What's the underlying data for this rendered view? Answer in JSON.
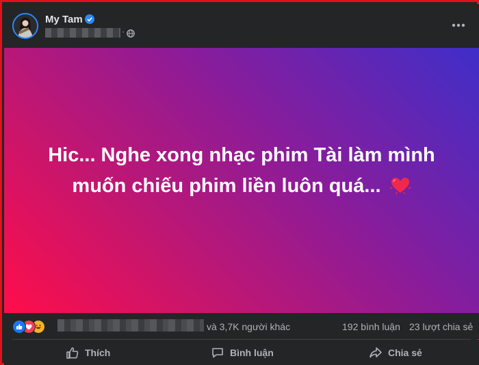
{
  "post": {
    "author": "My Tam",
    "status_text_line1": "Hic... Nghe xong nhạc phim Tài làm mình",
    "status_text_line2": "muốn chiếu phim liền luôn quá...",
    "background_colors": [
      "#ff0d4a",
      "#8a1c9a",
      "#3f2ec9"
    ]
  },
  "stats": {
    "others_text": "và 3,7K người khác",
    "comments": "192 bình luận",
    "shares": "23 lượt chia sẻ"
  },
  "actions": {
    "like": "Thích",
    "comment": "Bình luận",
    "share": "Chia sẻ"
  },
  "icons": [
    "verified-icon",
    "globe-icon",
    "more-icon",
    "heart-emoji-icon",
    "like-reaction-icon",
    "love-reaction-icon",
    "haha-reaction-icon",
    "thumbs-up-icon",
    "comment-icon",
    "share-icon"
  ]
}
